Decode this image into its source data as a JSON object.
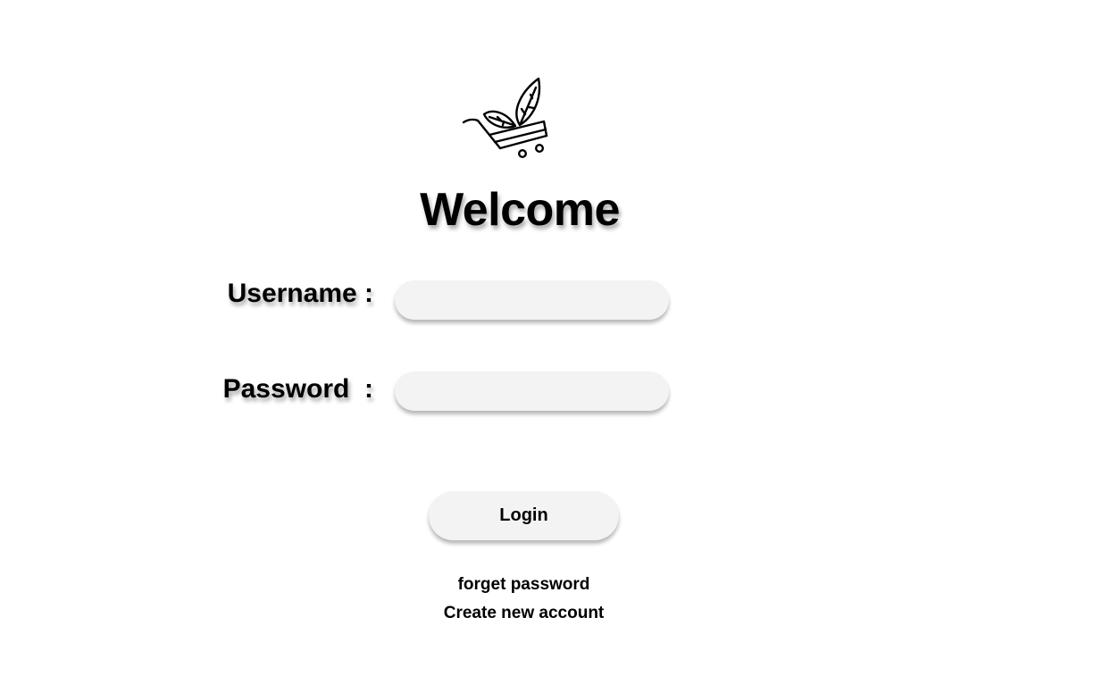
{
  "logo": {
    "icon": "leaf-shopping-cart-icon"
  },
  "welcome": {
    "title": "Welcome"
  },
  "form": {
    "username_label": "Username :",
    "username_value": "",
    "password_label": "Password  :",
    "password_value": "",
    "login_label": "Login"
  },
  "links": {
    "forget_password": "forget password",
    "create_account": "Create new account"
  },
  "colors": {
    "background": "#ffffff",
    "field_fill": "#f3f3f3",
    "text": "#000000"
  }
}
